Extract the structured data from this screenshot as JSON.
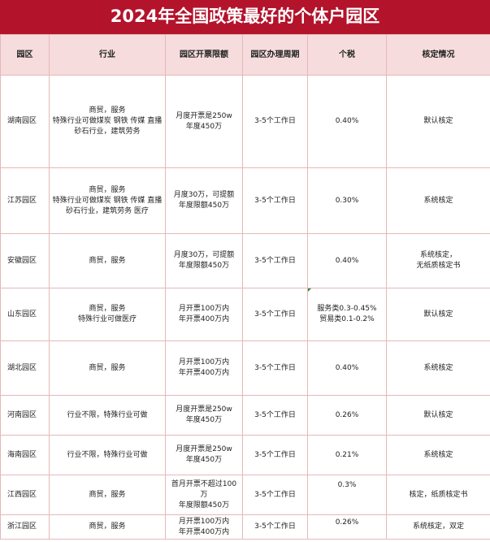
{
  "title": "2024年全国政策最好的个体户园区",
  "headers": [
    "园区",
    "行业",
    "园区开票限额",
    "园区办理周期",
    "个税",
    "核定情况"
  ],
  "rows": [
    {
      "region": "湖南园区",
      "industry": [
        "商贸，服务",
        "特殊行业可做煤炭 钢铁 传媒 直播",
        "砂石行业，建筑劳务"
      ],
      "limit": [
        "月度开票是250w",
        "年度450万"
      ],
      "cycle": "3-5个工作日",
      "tax": [
        "0.40%"
      ],
      "status": [
        "默认核定"
      ]
    },
    {
      "region": "江苏园区",
      "industry": [
        "商贸，服务",
        "特殊行业可做煤炭 钢铁 传媒 直播",
        "砂石行业，建筑劳务  医疗"
      ],
      "limit": [
        "月度30万，可提额",
        "年度限额450万"
      ],
      "cycle": "3-5个工作日",
      "tax": [
        "0.30%"
      ],
      "status": [
        "系统核定"
      ]
    },
    {
      "region": "安徽园区",
      "industry": [
        "商贸，服务"
      ],
      "limit": [
        "月度30万，可提额",
        "年度限额450万"
      ],
      "cycle": "3-5个工作日",
      "tax": [
        "0.40%"
      ],
      "status": [
        "系统核定，",
        "无纸质核定书"
      ]
    },
    {
      "region": "山东园区",
      "industry": [
        "商贸，服务",
        "特殊行业可做医疗"
      ],
      "limit": [
        "月开票100万内",
        "年开票400万内"
      ],
      "cycle": "3-5个工作日",
      "tax": [
        "服务类0.3-0.45%",
        "贸易类0.1-0.2%"
      ],
      "status": [
        "默认核定"
      ]
    },
    {
      "region": "湖北园区",
      "industry": [
        "商贸，服务"
      ],
      "limit": [
        "月开票100万内",
        "年开票400万内"
      ],
      "cycle": "3-5个工作日",
      "tax": [
        "0.40%"
      ],
      "status": [
        "系统核定"
      ]
    },
    {
      "region": "河南园区",
      "industry": [
        "行业不限，特殊行业可做"
      ],
      "limit": [
        "月度开票是250w",
        "年度450万"
      ],
      "cycle": "3-5个工作日",
      "tax": [
        "0.26%"
      ],
      "status": [
        "默认核定"
      ]
    },
    {
      "region": "海南园区",
      "industry": [
        "行业不限，特殊行业可做"
      ],
      "limit": [
        "月度开票是250w",
        "年度450万"
      ],
      "cycle": "3-5个工作日",
      "tax": [
        "0.21%"
      ],
      "status": [
        "系统核定"
      ]
    },
    {
      "region": "江西园区",
      "industry": [
        "商贸，服务"
      ],
      "limit": [
        "首月开票不超过100",
        "万",
        "年度限额450万"
      ],
      "cycle": "3-5个工作日",
      "tax": [
        "0.3%"
      ],
      "status": [
        "核定，纸质核定书"
      ]
    },
    {
      "region": "浙江园区",
      "industry": [
        "商贸，服务"
      ],
      "limit": [
        "月开票100万内",
        "年开票400万内"
      ],
      "cycle": "3-5个工作日",
      "tax": [
        "0.26%"
      ],
      "status": [
        "系统核定，双定"
      ]
    }
  ]
}
